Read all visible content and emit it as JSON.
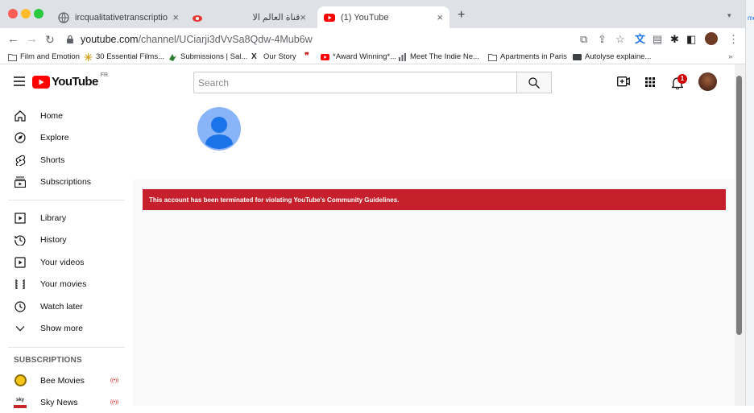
{
  "browser": {
    "tabs": [
      {
        "title": "ircqualitativetranscriptionandtr",
        "icon": "globe-icon"
      },
      {
        "title": "",
        "icon": "eye-logo-icon"
      },
      {
        "title": "قناة العالم الاخبارية",
        "icon": "none"
      },
      {
        "title": "(1) YouTube",
        "icon": "youtube-icon",
        "active": true
      }
    ],
    "url_host": "youtube.com",
    "url_path": "/channel/UCiarji3dVvSa8Qdw-4Mub6w",
    "bookmarks": [
      {
        "label": "Film and Emotion",
        "icon": "folder-icon"
      },
      {
        "label": "30 Essential Films...",
        "icon": "starburst-icon"
      },
      {
        "label": "Submissions | Sal...",
        "icon": "submission-icon"
      },
      {
        "label": "Our Story",
        "icon": "x-logo-icon"
      },
      {
        "label": "",
        "icon": "quote-icon"
      },
      {
        "label": "*Award Winning*...",
        "icon": "youtube-icon"
      },
      {
        "label": "Meet The Indie Ne...",
        "icon": "chart-icon"
      },
      {
        "label": "Apartments in Paris",
        "icon": "folder-icon"
      },
      {
        "label": "Autolyse explaine...",
        "icon": "video-icon"
      }
    ],
    "more_bookmarks": "»",
    "right_strip_text": "me"
  },
  "youtube": {
    "logo_text": "YouTube",
    "region": "FR",
    "search_placeholder": "Search",
    "notification_count": "1",
    "sidebar": {
      "items": [
        {
          "label": "Home",
          "icon": "home-icon"
        },
        {
          "label": "Explore",
          "icon": "compass-icon"
        },
        {
          "label": "Shorts",
          "icon": "shorts-icon"
        },
        {
          "label": "Subscriptions",
          "icon": "subscriptions-icon"
        },
        {
          "label": "Library",
          "icon": "library-icon"
        },
        {
          "label": "History",
          "icon": "history-icon"
        },
        {
          "label": "Your videos",
          "icon": "your-videos-icon"
        },
        {
          "label": "Your movies",
          "icon": "movies-icon"
        },
        {
          "label": "Watch later",
          "icon": "clock-icon"
        },
        {
          "label": "Show more",
          "icon": "chevron-down-icon"
        }
      ],
      "subscriptions_heading": "SUBSCRIPTIONS",
      "subscriptions": [
        {
          "label": "Bee Movies",
          "live": "((•))"
        },
        {
          "label": "Sky News",
          "live": "((•))"
        }
      ]
    },
    "banner_text": "This account has been terminated for violating YouTube's Community Guidelines."
  },
  "colors": {
    "youtube_red": "#ff0000",
    "banner_red": "#c5202b",
    "avatar_blue": "#8ab4f8",
    "avatar_dark_blue": "#1a73e8"
  }
}
